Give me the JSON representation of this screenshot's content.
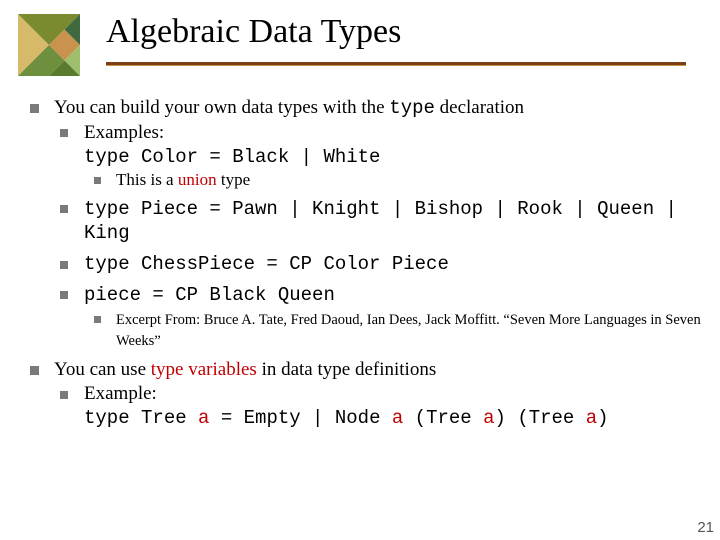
{
  "title": "Algebraic Data Types",
  "p1": {
    "a": "You can build your own data types with the ",
    "b": "type",
    "c": " declaration"
  },
  "ex": {
    "label": "Examples:",
    "color": "type Color = Black | White",
    "union": {
      "a": "This is a ",
      "b": "union",
      "c": " type"
    },
    "piece": "type Piece = Pawn | Knight | Bishop | Rook | Queen | King",
    "chess": "type ChessPiece = CP Color Piece",
    "val": "piece = CP Black Queen",
    "excerpt": "Excerpt From: Bruce A. Tate, Fred Daoud, Ian Dees, Jack Moffitt. “Seven More Languages in Seven Weeks”"
  },
  "p2": {
    "a": "You can use ",
    "b": "type variables",
    "c": " in data type definitions"
  },
  "tree": {
    "label": "Example:",
    "l": {
      "t1": "type Tree ",
      "a1": "a",
      "eq": " = Empty | Node ",
      "a2": "a",
      "p1": " (Tree ",
      "a3": "a",
      "p2": ") (Tree ",
      "a4": "a",
      "p3": ")"
    }
  },
  "page": "21"
}
